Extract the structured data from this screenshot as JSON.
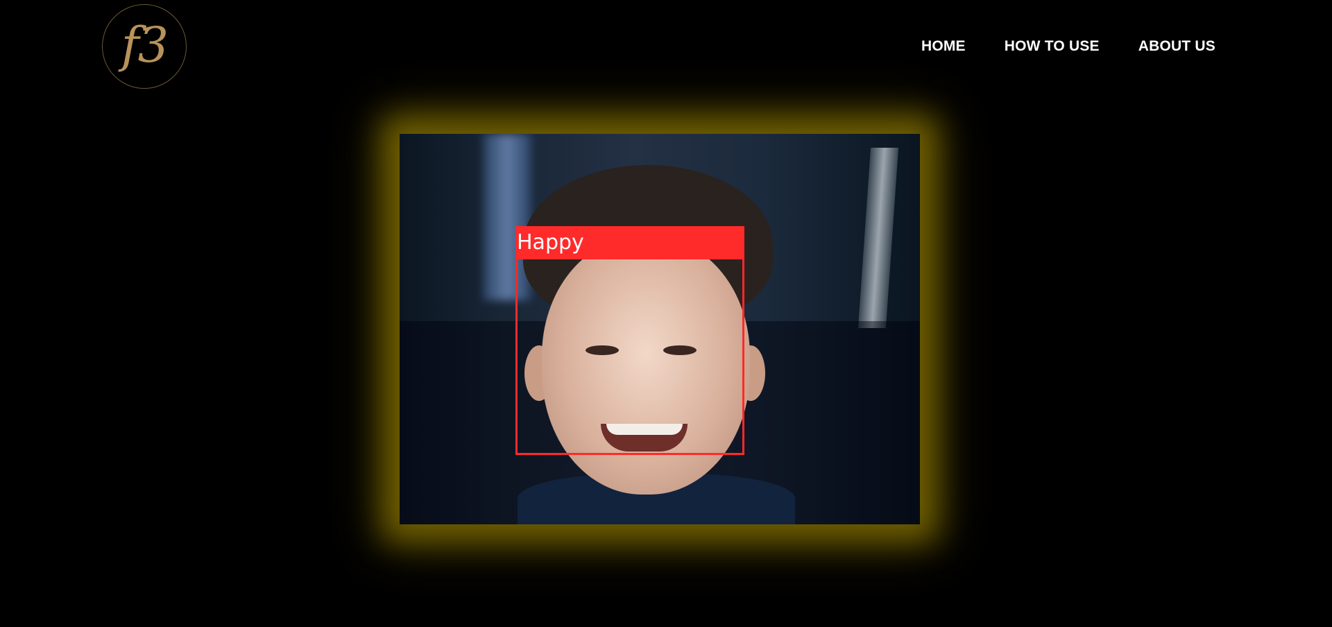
{
  "logo": {
    "text": "f3",
    "color": "#b8935a"
  },
  "nav": {
    "items": [
      {
        "label": "HOME"
      },
      {
        "label": "HOW TO USE"
      },
      {
        "label": "ABOUT US"
      }
    ]
  },
  "video": {
    "detection": {
      "label": "Happy",
      "box_color": "#ff2a2a"
    },
    "glow_color": "#6e5e00"
  }
}
